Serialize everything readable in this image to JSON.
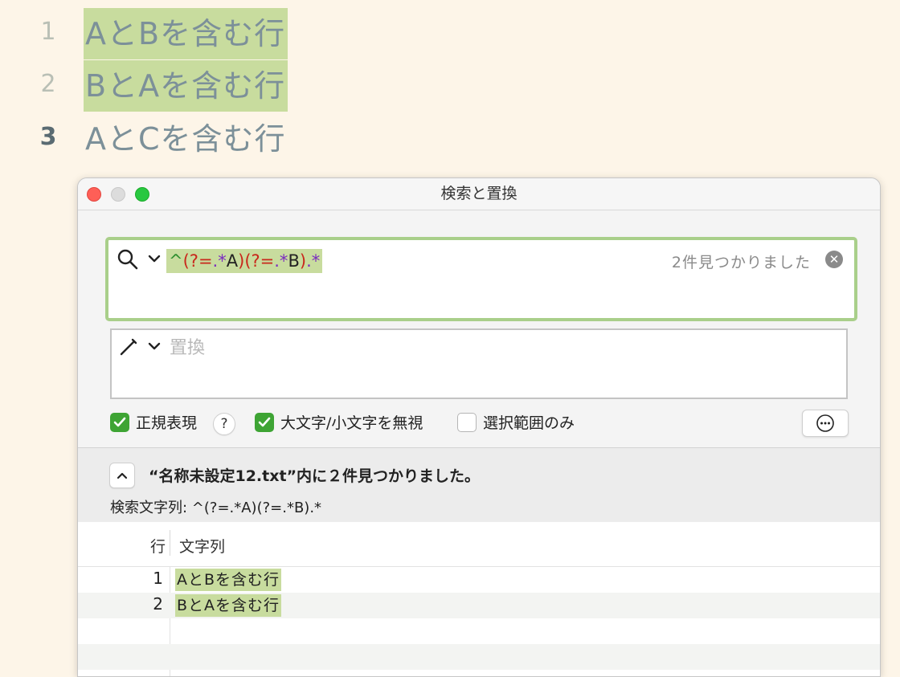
{
  "editor": {
    "lines": [
      {
        "number": "1",
        "text": "AとBを含む行"
      },
      {
        "number": "2",
        "text": "BとAを含む行"
      },
      {
        "number": "3",
        "text": "AとCを含む行"
      }
    ]
  },
  "window": {
    "title": "検索と置換"
  },
  "search": {
    "query_parts": [
      "^",
      "(?=",
      ".*",
      "A",
      ")",
      "(?=",
      ".*",
      "B",
      ")",
      ".*"
    ],
    "match_count": "2件見つかりました"
  },
  "replace": {
    "placeholder": "置換",
    "value": ""
  },
  "options": {
    "regex_label": "正規表現",
    "regex_checked": true,
    "help_label": "?",
    "ignore_case_label": "大文字/小文字を無視",
    "ignore_case_checked": true,
    "selection_only_label": "選択範囲のみ",
    "selection_only_checked": false
  },
  "results": {
    "title": "“名称未設定12.txt”内に２件見つかりました。",
    "search_string": "検索文字列: ^(?=.*A)(?=.*B).*",
    "columns": {
      "line": "行",
      "string": "文字列"
    },
    "rows": [
      {
        "line": "1",
        "text": "AとBを含む行"
      },
      {
        "line": "2",
        "text": "BとAを含む行"
      }
    ]
  },
  "colors": {
    "background": "#fdf5e8",
    "highlight": "#c8dc9e",
    "checkbox": "#3ea434",
    "regex_red": "#c9281c",
    "regex_purple": "#7a2cc0"
  }
}
